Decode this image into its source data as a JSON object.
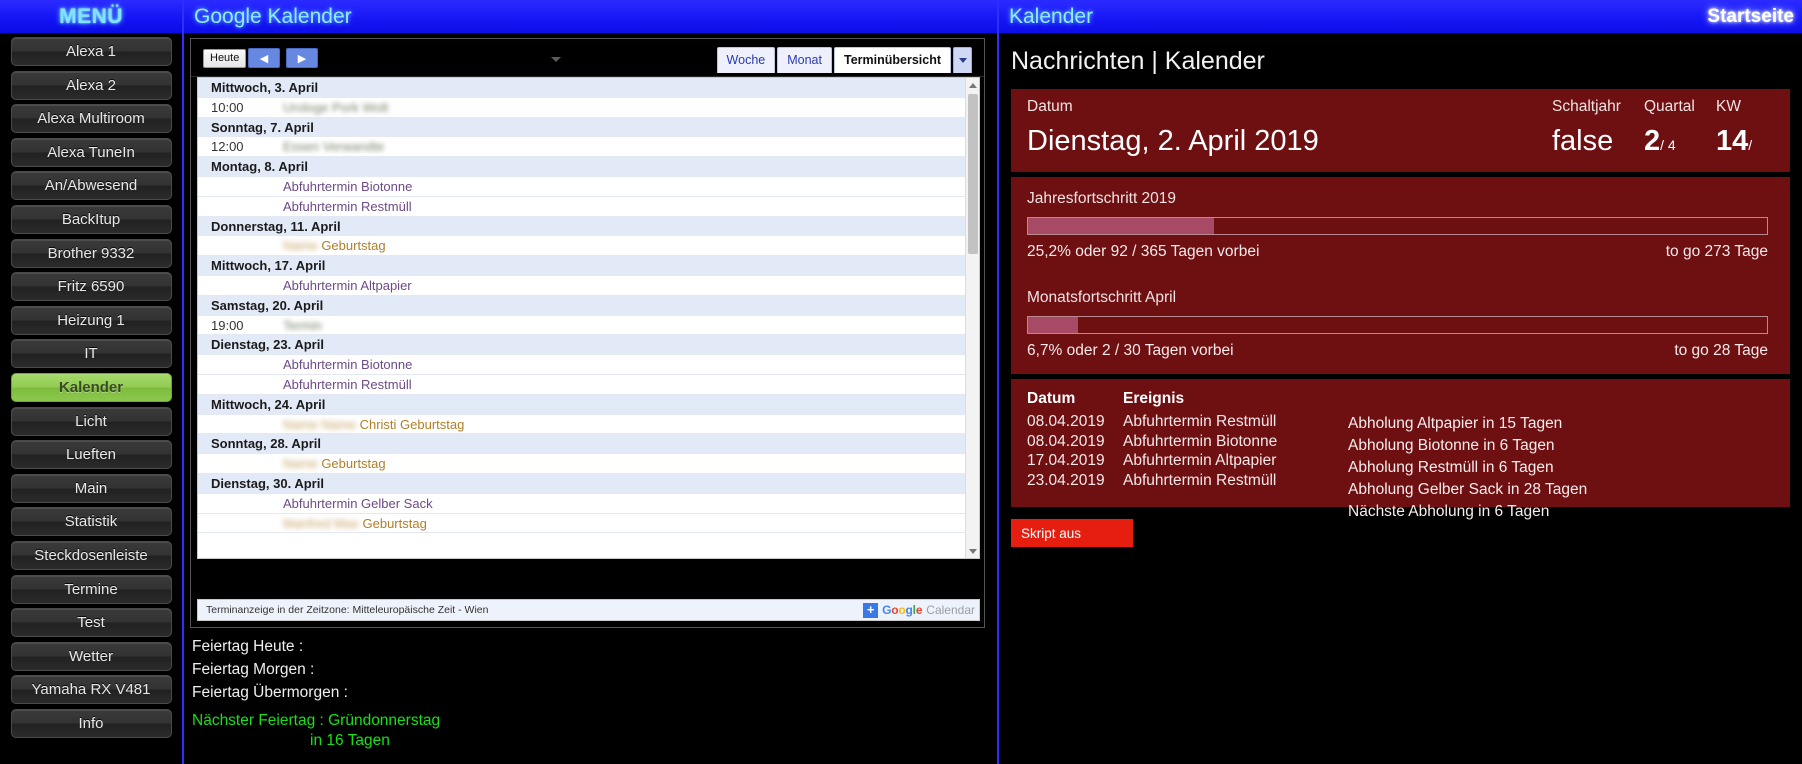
{
  "sidebar": {
    "header": "MENÜ",
    "items": [
      {
        "label": "Alexa 1",
        "active": false
      },
      {
        "label": "Alexa 2",
        "active": false
      },
      {
        "label": "Alexa Multiroom",
        "active": false
      },
      {
        "label": "Alexa TuneIn",
        "active": false
      },
      {
        "label": "An/Abwesend",
        "active": false
      },
      {
        "label": "BackItup",
        "active": false
      },
      {
        "label": "Brother 9332",
        "active": false
      },
      {
        "label": "Fritz 6590",
        "active": false
      },
      {
        "label": "Heizung 1",
        "active": false
      },
      {
        "label": "IT",
        "active": false
      },
      {
        "label": "Kalender",
        "active": true
      },
      {
        "label": "Licht",
        "active": false
      },
      {
        "label": "Lueften",
        "active": false
      },
      {
        "label": "Main",
        "active": false
      },
      {
        "label": "Statistik",
        "active": false
      },
      {
        "label": "Steckdosenleiste",
        "active": false
      },
      {
        "label": "Termine",
        "active": false
      },
      {
        "label": "Test",
        "active": false
      },
      {
        "label": "Wetter",
        "active": false
      },
      {
        "label": "Yamaha RX V481",
        "active": false
      },
      {
        "label": "Info",
        "active": false
      }
    ]
  },
  "center": {
    "header": "Google Kalender",
    "toolbar": {
      "today_label": "Heute",
      "prev_icon": "chevron-left-icon",
      "next_icon": "chevron-right-icon",
      "print_icon": "print-icon",
      "tabs": [
        {
          "label": "Woche",
          "selected": false
        },
        {
          "label": "Monat",
          "selected": false
        },
        {
          "label": "Terminübersicht",
          "selected": true
        }
      ],
      "tab_caret_icon": "chevron-down-icon"
    },
    "agenda": [
      {
        "type": "day",
        "label": "Mittwoch, 3. April"
      },
      {
        "type": "event",
        "time": "10:00",
        "title": "Urologe Pork Wolt",
        "style": "blur"
      },
      {
        "type": "day",
        "label": "Sonntag, 7. April"
      },
      {
        "type": "event",
        "time": "12:00",
        "title": "Essen Verwandte",
        "style": "blur"
      },
      {
        "type": "day",
        "label": "Montag, 8. April"
      },
      {
        "type": "event",
        "time": "",
        "title": "Abfuhrtermin Biotonne",
        "style": "normal"
      },
      {
        "type": "event",
        "time": "",
        "title": "Abfuhrtermin Restmüll",
        "style": "normal"
      },
      {
        "type": "day",
        "label": "Donnerstag, 11. April"
      },
      {
        "type": "event",
        "time": "",
        "title": "Geburtstag",
        "style": "partblur",
        "prefix": "Name"
      },
      {
        "type": "day",
        "label": "Mittwoch, 17. April"
      },
      {
        "type": "event",
        "time": "",
        "title": "Abfuhrtermin Altpapier",
        "style": "normal"
      },
      {
        "type": "day",
        "label": "Samstag, 20. April"
      },
      {
        "type": "event",
        "time": "19:00",
        "title": "Termin",
        "style": "blur"
      },
      {
        "type": "day",
        "label": "Dienstag, 23. April"
      },
      {
        "type": "event",
        "time": "",
        "title": "Abfuhrtermin Biotonne",
        "style": "normal"
      },
      {
        "type": "event",
        "time": "",
        "title": "Abfuhrtermin Restmüll",
        "style": "normal"
      },
      {
        "type": "day",
        "label": "Mittwoch, 24. April"
      },
      {
        "type": "event",
        "time": "",
        "title": "Christi Geburtstag",
        "style": "partblur",
        "prefix": "Name Name"
      },
      {
        "type": "day",
        "label": "Sonntag, 28. April"
      },
      {
        "type": "event",
        "time": "",
        "title": "Geburtstag",
        "style": "partblur",
        "prefix": "Name"
      },
      {
        "type": "day",
        "label": "Dienstag, 30. April"
      },
      {
        "type": "event",
        "time": "",
        "title": "Abfuhrtermin Gelber Sack",
        "style": "normal"
      },
      {
        "type": "event",
        "time": "",
        "title": "Geburtstag",
        "style": "partblur",
        "prefix": "Manfred Max"
      }
    ],
    "footer": {
      "timezone_text": "Terminanzeige in der Zeitzone: Mitteleuropäische Zeit - Wien",
      "brand_plus": "+",
      "brand_google": "Google",
      "brand_calendar": "Calendar"
    },
    "feiertage": {
      "today": "Feiertag Heute :",
      "tomorrow": "Feiertag Morgen :",
      "day_after": "Feiertag Übermorgen :",
      "next": "Nächster Feiertag : Gründonnerstag",
      "next_days": "in 16 Tagen"
    }
  },
  "right": {
    "header_title": "Kalender",
    "home_label": "Startseite",
    "page_title": "Nachrichten | Kalender",
    "date_card": {
      "label_datum": "Datum",
      "label_schaltjahr": "Schaltjahr",
      "label_quartal": "Quartal",
      "label_kw": "KW",
      "value_datum": "Dienstag, 2. April 2019",
      "value_schaltjahr": "false",
      "value_quartal": "2",
      "value_quartal_sub": "/ 4",
      "value_kw": "14",
      "value_kw_sub": "/"
    },
    "progress": {
      "year": {
        "label": "Jahresfortschritt 2019",
        "percent": 25.2,
        "caption": "25,2% oder 92 / 365 Tagen vorbei",
        "togo": "to go 273 Tage"
      },
      "month": {
        "label": "Monatsfortschritt April",
        "percent": 6.7,
        "caption": "6,7% oder 2 / 30 Tagen vorbei",
        "togo": "to go 28 Tage"
      }
    },
    "table": {
      "headers": [
        "Datum",
        "Ereignis"
      ],
      "rows": [
        {
          "date": "08.04.2019",
          "event": "Abfuhrtermin Restmüll"
        },
        {
          "date": "08.04.2019",
          "event": "Abfuhrtermin Biotonne"
        },
        {
          "date": "17.04.2019",
          "event": "Abfuhrtermin Altpapier"
        },
        {
          "date": "23.04.2019",
          "event": "Abfuhrtermin Restmüll"
        }
      ],
      "notices": [
        "Abholung Altpapier in 15 Tagen",
        "Abholung Biotonne in 6 Tagen",
        "Abholung Restmüll in 6 Tagen",
        "Abholung Gelber Sack in 28 Tagen",
        "Nächste Abholung in 6 Tagen"
      ]
    },
    "skript_button": "Skript aus"
  },
  "colors": {
    "accent_blue": "#1717f6",
    "header_text": "#8febff",
    "card_red": "#6e0f12",
    "progress_fill": "#a84a66",
    "active_green": "#92cc53",
    "skript_red": "#e61e10",
    "holiday_green": "#19e019"
  }
}
